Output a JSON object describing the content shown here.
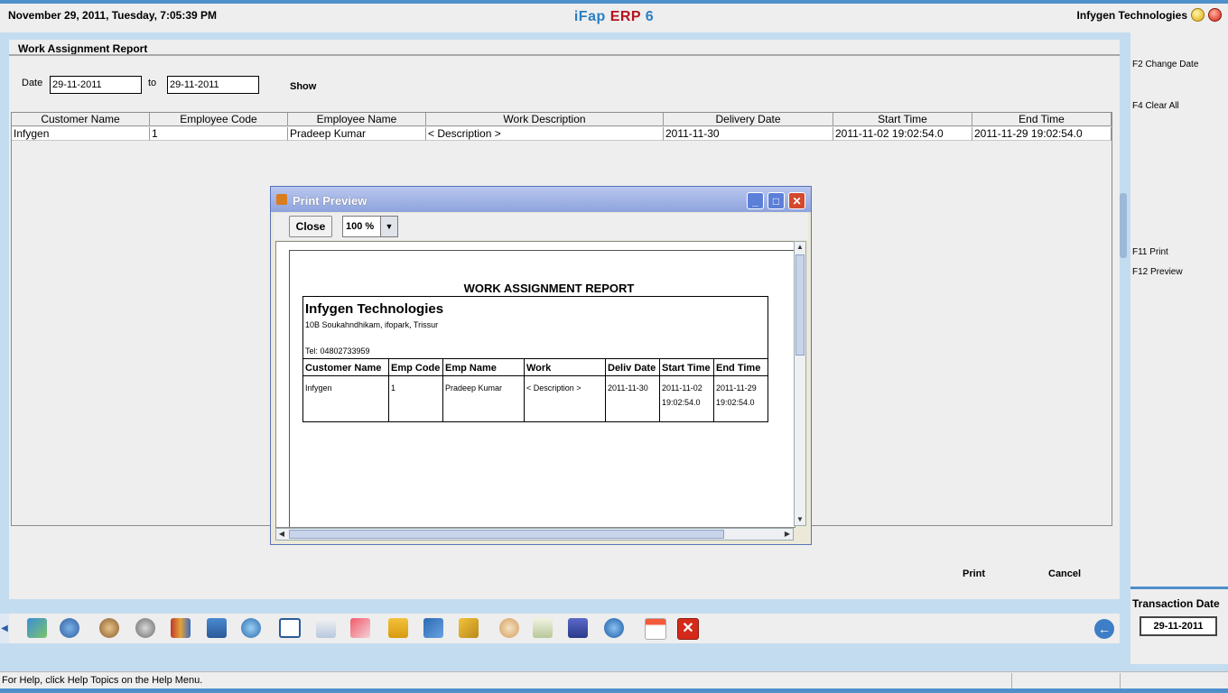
{
  "topbar": {
    "datetime": "November  29, 2011, Tuesday, 7:05:39 PM",
    "app_title_a": "iFap",
    "app_title_b": "ERP",
    "app_title_c": "6",
    "company": "Infygen Technologies"
  },
  "main": {
    "title": "Work Assignment Report",
    "date_label": "Date",
    "date_from": "29-11-2011",
    "to_label": "to",
    "date_to": "29-11-2011",
    "show_label": "Show",
    "print_label": "Print",
    "cancel_label": "Cancel",
    "table": {
      "columns": [
        "Customer Name",
        "Employee Code",
        "Employee Name",
        "Work Description",
        "Delivery Date",
        "Start Time",
        "End Time"
      ],
      "rows": [
        [
          "Infygen",
          "1",
          "Pradeep  Kumar",
          "< Description >",
          "2011-11-30",
          "2011-11-02 19:02:54.0",
          "2011-11-29 19:02:54.0"
        ]
      ]
    }
  },
  "right_panel": {
    "f2": "F2 Change Date",
    "f4": "F4 Clear All",
    "f11": "F11 Print",
    "f12": "F12 Preview",
    "transaction_label": "Transaction Date",
    "transaction_date": "29-11-2011"
  },
  "toolbar": {
    "icons": [
      "map-icon",
      "user-phone-icon",
      "people-icon",
      "gears-icon",
      "books-icon",
      "cart-icon",
      "sync-icon",
      "window-icon",
      "search-doc-icon",
      "ruler-icon",
      "hierarchy-icon",
      "network-icon",
      "box-icon",
      "tools-icon",
      "checklist-icon",
      "save-icon",
      "settings-icon",
      "calendar-icon",
      "exit-icon"
    ]
  },
  "status": {
    "text": "For Help, click Help Topics on the Help Menu."
  },
  "print_preview": {
    "title": "Print Preview",
    "close_label": "Close",
    "zoom": "100 %",
    "report": {
      "heading": "WORK ASSIGNMENT REPORT",
      "company": "Infygen Technologies",
      "address": "10B Soukahndhikam, ifopark, Trissur",
      "tel": "Tel: 04802733959",
      "columns": [
        "Customer Name",
        "Emp Code",
        "Emp Name",
        "Work",
        "Deliv Date",
        "Start Time",
        "End Time"
      ],
      "row": [
        "Infygen",
        "1",
        "Pradeep  Kumar",
        "< Description >",
        "2011-11-30",
        "2011-11-02 19:02:54.0",
        "2011-11-29 19:02:54.0"
      ]
    }
  }
}
